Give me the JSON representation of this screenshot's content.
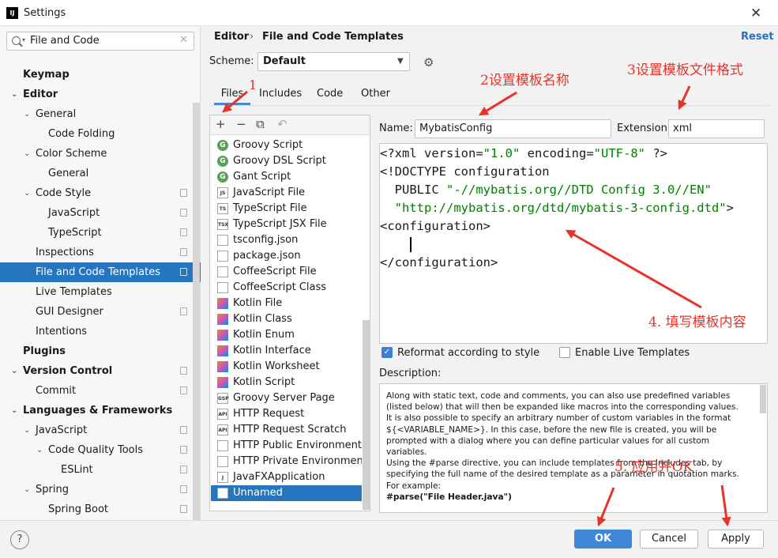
{
  "window": {
    "title": "Settings",
    "app_icon": "intellij-icon",
    "close_glyph": "✕"
  },
  "search": {
    "value": "File and Code",
    "clear_glyph": "✕"
  },
  "tree": [
    {
      "label": "Keymap",
      "bold": true,
      "indent": 0,
      "arrow": ""
    },
    {
      "label": "Editor",
      "bold": true,
      "indent": 0,
      "arrow": "down"
    },
    {
      "label": "General",
      "indent": 1,
      "arrow": "down"
    },
    {
      "label": "Code Folding",
      "indent": 2,
      "arrow": ""
    },
    {
      "label": "Color Scheme",
      "indent": 1,
      "arrow": "down"
    },
    {
      "label": "General",
      "indent": 2,
      "arrow": ""
    },
    {
      "label": "Code Style",
      "indent": 1,
      "arrow": "down",
      "project": true
    },
    {
      "label": "JavaScript",
      "indent": 2,
      "arrow": "",
      "project": true
    },
    {
      "label": "TypeScript",
      "indent": 2,
      "arrow": "",
      "project": true
    },
    {
      "label": "Inspections",
      "indent": 1,
      "arrow": "",
      "project": true
    },
    {
      "label": "File and Code Templates",
      "indent": 1,
      "arrow": "",
      "project": true,
      "selected": true
    },
    {
      "label": "Live Templates",
      "indent": 1,
      "arrow": ""
    },
    {
      "label": "GUI Designer",
      "indent": 1,
      "arrow": "",
      "project": true
    },
    {
      "label": "Intentions",
      "indent": 1,
      "arrow": ""
    },
    {
      "label": "Plugins",
      "bold": true,
      "indent": 0,
      "arrow": ""
    },
    {
      "label": "Version Control",
      "bold": true,
      "indent": 0,
      "arrow": "down",
      "project": true
    },
    {
      "label": "Commit",
      "indent": 1,
      "arrow": "",
      "project": true
    },
    {
      "label": "Languages & Frameworks",
      "bold": true,
      "indent": 0,
      "arrow": "down"
    },
    {
      "label": "JavaScript",
      "indent": 1,
      "arrow": "down",
      "project": true
    },
    {
      "label": "Code Quality Tools",
      "indent": 2,
      "arrow": "down",
      "project": true
    },
    {
      "label": "ESLint",
      "indent": 3,
      "arrow": "",
      "project": true
    },
    {
      "label": "Spring",
      "indent": 1,
      "arrow": "down",
      "project": true
    },
    {
      "label": "Spring Boot",
      "indent": 2,
      "arrow": "",
      "project": true
    }
  ],
  "breadcrumb": {
    "parent": "Editor",
    "separator": "›",
    "current": "File and Code Templates"
  },
  "reset_label": "Reset",
  "scheme": {
    "label": "Scheme:",
    "value": "Default"
  },
  "tabs": [
    "Files",
    "Includes",
    "Code",
    "Other"
  ],
  "toolbar": {
    "add": "+",
    "remove": "−",
    "copy": "⧉",
    "revert": "↶"
  },
  "templates": [
    {
      "label": "Groovy Script",
      "icon": "groovy-icon",
      "kind": "g",
      "glyph": "G"
    },
    {
      "label": "Groovy DSL Script",
      "icon": "groovy-icon",
      "kind": "g",
      "glyph": "G"
    },
    {
      "label": "Gant Script",
      "icon": "groovy-icon",
      "kind": "g",
      "glyph": "G"
    },
    {
      "label": "JavaScript File",
      "icon": "javascript-file-icon",
      "kind": "doc",
      "glyph": "JS"
    },
    {
      "label": "TypeScript File",
      "icon": "typescript-file-icon",
      "kind": "doc",
      "glyph": "TS"
    },
    {
      "label": "TypeScript JSX File",
      "icon": "tsx-file-icon",
      "kind": "doc",
      "glyph": "TSX"
    },
    {
      "label": "tsconfig.json",
      "icon": "json-file-icon",
      "kind": "doc",
      "glyph": ""
    },
    {
      "label": "package.json",
      "icon": "json-file-icon",
      "kind": "doc",
      "glyph": ""
    },
    {
      "label": "CoffeeScript File",
      "icon": "coffeescript-file-icon",
      "kind": "doc",
      "glyph": ""
    },
    {
      "label": "CoffeeScript Class",
      "icon": "coffeescript-file-icon",
      "kind": "doc",
      "glyph": ""
    },
    {
      "label": "Kotlin File",
      "icon": "kotlin-icon",
      "kind": "kt",
      "glyph": ""
    },
    {
      "label": "Kotlin Class",
      "icon": "kotlin-icon",
      "kind": "kt",
      "glyph": ""
    },
    {
      "label": "Kotlin Enum",
      "icon": "kotlin-icon",
      "kind": "kt",
      "glyph": ""
    },
    {
      "label": "Kotlin Interface",
      "icon": "kotlin-icon",
      "kind": "kt",
      "glyph": ""
    },
    {
      "label": "Kotlin Worksheet",
      "icon": "kotlin-icon",
      "kind": "kt",
      "glyph": ""
    },
    {
      "label": "Kotlin Script",
      "icon": "kotlin-icon",
      "kind": "kt",
      "glyph": ""
    },
    {
      "label": "Groovy Server Page",
      "icon": "gsp-file-icon",
      "kind": "doc",
      "glyph": "GSP"
    },
    {
      "label": "HTTP Request",
      "icon": "api-file-icon",
      "kind": "doc",
      "glyph": "API"
    },
    {
      "label": "HTTP Request Scratch",
      "icon": "api-file-icon",
      "kind": "doc",
      "glyph": "API"
    },
    {
      "label": "HTTP Public Environment File",
      "icon": "file-icon",
      "kind": "doc",
      "glyph": ""
    },
    {
      "label": "HTTP Private Environment File",
      "icon": "file-icon",
      "kind": "doc",
      "glyph": ""
    },
    {
      "label": "JavaFXApplication",
      "icon": "java-file-icon",
      "kind": "doc",
      "glyph": "J"
    },
    {
      "label": "Unnamed",
      "icon": "file-icon",
      "kind": "doc",
      "glyph": "",
      "selected": true
    }
  ],
  "name_field": {
    "label": "Name:",
    "value": "MybatisConfig"
  },
  "extension_field": {
    "label": "Extension:",
    "value": "xml"
  },
  "code": [
    [
      [
        "<?xml version=",
        ""
      ],
      [
        "\"1.0\"",
        "str"
      ],
      [
        " encoding=",
        ""
      ],
      [
        "\"UTF-8\"",
        "str"
      ],
      [
        " ?>",
        ""
      ]
    ],
    [
      [
        "<!DOCTYPE configuration",
        ""
      ]
    ],
    [
      [
        "  PUBLIC ",
        ""
      ],
      [
        "\"-//mybatis.org//DTD Config 3.0//EN\"",
        "str"
      ]
    ],
    [
      [
        "  ",
        ""
      ],
      [
        "\"http://mybatis.org/dtd/mybatis-3-config.dtd\"",
        "str"
      ],
      [
        ">",
        ""
      ]
    ],
    [
      [
        "<configuration>",
        ""
      ]
    ],
    [
      [
        "",
        ""
      ]
    ],
    [
      [
        "</configuration>",
        ""
      ]
    ]
  ],
  "options": {
    "reformat": {
      "label": "Reformat according to style",
      "checked": true
    },
    "live_templates": {
      "label": "Enable Live Templates",
      "checked": false
    }
  },
  "description": {
    "label": "Description:",
    "paragraphs": [
      "Along with static text, code and comments, you can also use predefined variables (listed below) that will then be expanded like macros into the corresponding values.",
      "It is also possible to specify an arbitrary number of custom variables in the format ${<VARIABLE_NAME>}. In this case, before the new file is created, you will be prompted with a dialog where you can define particular values for all custom variables.",
      "Using the #parse directive, you can include templates from the Includes tab, by specifying the full name of the desired template as a parameter in quotation marks. For example:",
      "#parse(\"File Header.java\")"
    ]
  },
  "buttons": {
    "ok": "OK",
    "cancel": "Cancel",
    "apply": "Apply",
    "help": "?"
  },
  "annotations": {
    "a1": "1",
    "a2": "2设置模板名称",
    "a3": "3设置模板文件格式",
    "a4": "4. 填写模板内容",
    "a5": "5. 应用并OK"
  },
  "colors": {
    "selection": "#2675bf",
    "accent": "#3f88d8",
    "annotation": "#e8332b",
    "string": "#008000"
  }
}
